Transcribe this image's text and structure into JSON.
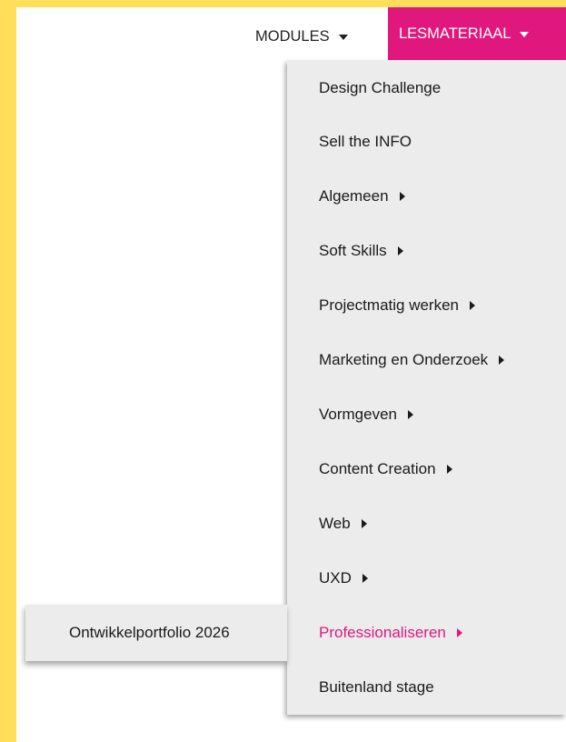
{
  "nav": {
    "modules_label": "MODULES",
    "lesmateriaal_label": "LESMATERIAAL"
  },
  "menu": {
    "items": [
      {
        "label": "Design Challenge",
        "has_submenu": false
      },
      {
        "label": "Sell the INFO",
        "has_submenu": false
      },
      {
        "label": "Algemeen",
        "has_submenu": true
      },
      {
        "label": "Soft Skills",
        "has_submenu": true
      },
      {
        "label": "Projectmatig werken",
        "has_submenu": true
      },
      {
        "label": "Marketing en Onderzoek",
        "has_submenu": true
      },
      {
        "label": "Vormgeven",
        "has_submenu": true
      },
      {
        "label": "Content Creation",
        "has_submenu": true
      },
      {
        "label": "Web",
        "has_submenu": true
      },
      {
        "label": "UXD",
        "has_submenu": true
      },
      {
        "label": "Professionaliseren",
        "has_submenu": true,
        "active": true
      },
      {
        "label": "Buitenland stage",
        "has_submenu": false
      }
    ]
  },
  "submenu": {
    "items": [
      {
        "label": "Ontwikkelportfolio 2026"
      }
    ]
  },
  "colors": {
    "accent": "#e0187d",
    "page_background": "#ffdf5a",
    "menu_background": "#ececec"
  },
  "icons": {
    "dropdown_caret": "caret-down-icon",
    "submenu_caret": "caret-right-icon"
  }
}
